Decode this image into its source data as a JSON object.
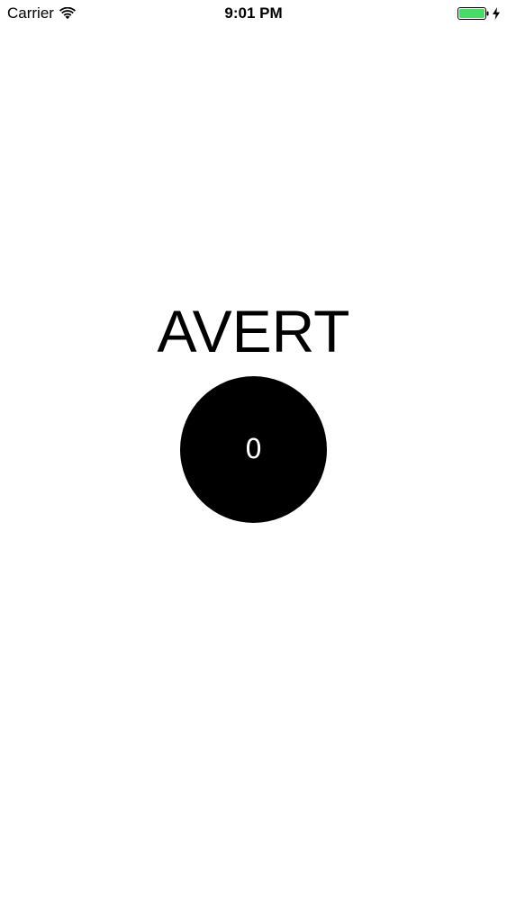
{
  "status_bar": {
    "carrier": "Carrier",
    "time": "9:01 PM",
    "wifi_icon": "wifi-icon",
    "battery_icon": "battery-icon",
    "charging_icon": "charging-bolt-icon",
    "battery_level_fraction": 1.0,
    "battery_color": "#4cd964"
  },
  "main": {
    "title": "AVERT",
    "counter": {
      "value": "0",
      "background_color": "#000000",
      "text_color": "#ffffff"
    }
  }
}
